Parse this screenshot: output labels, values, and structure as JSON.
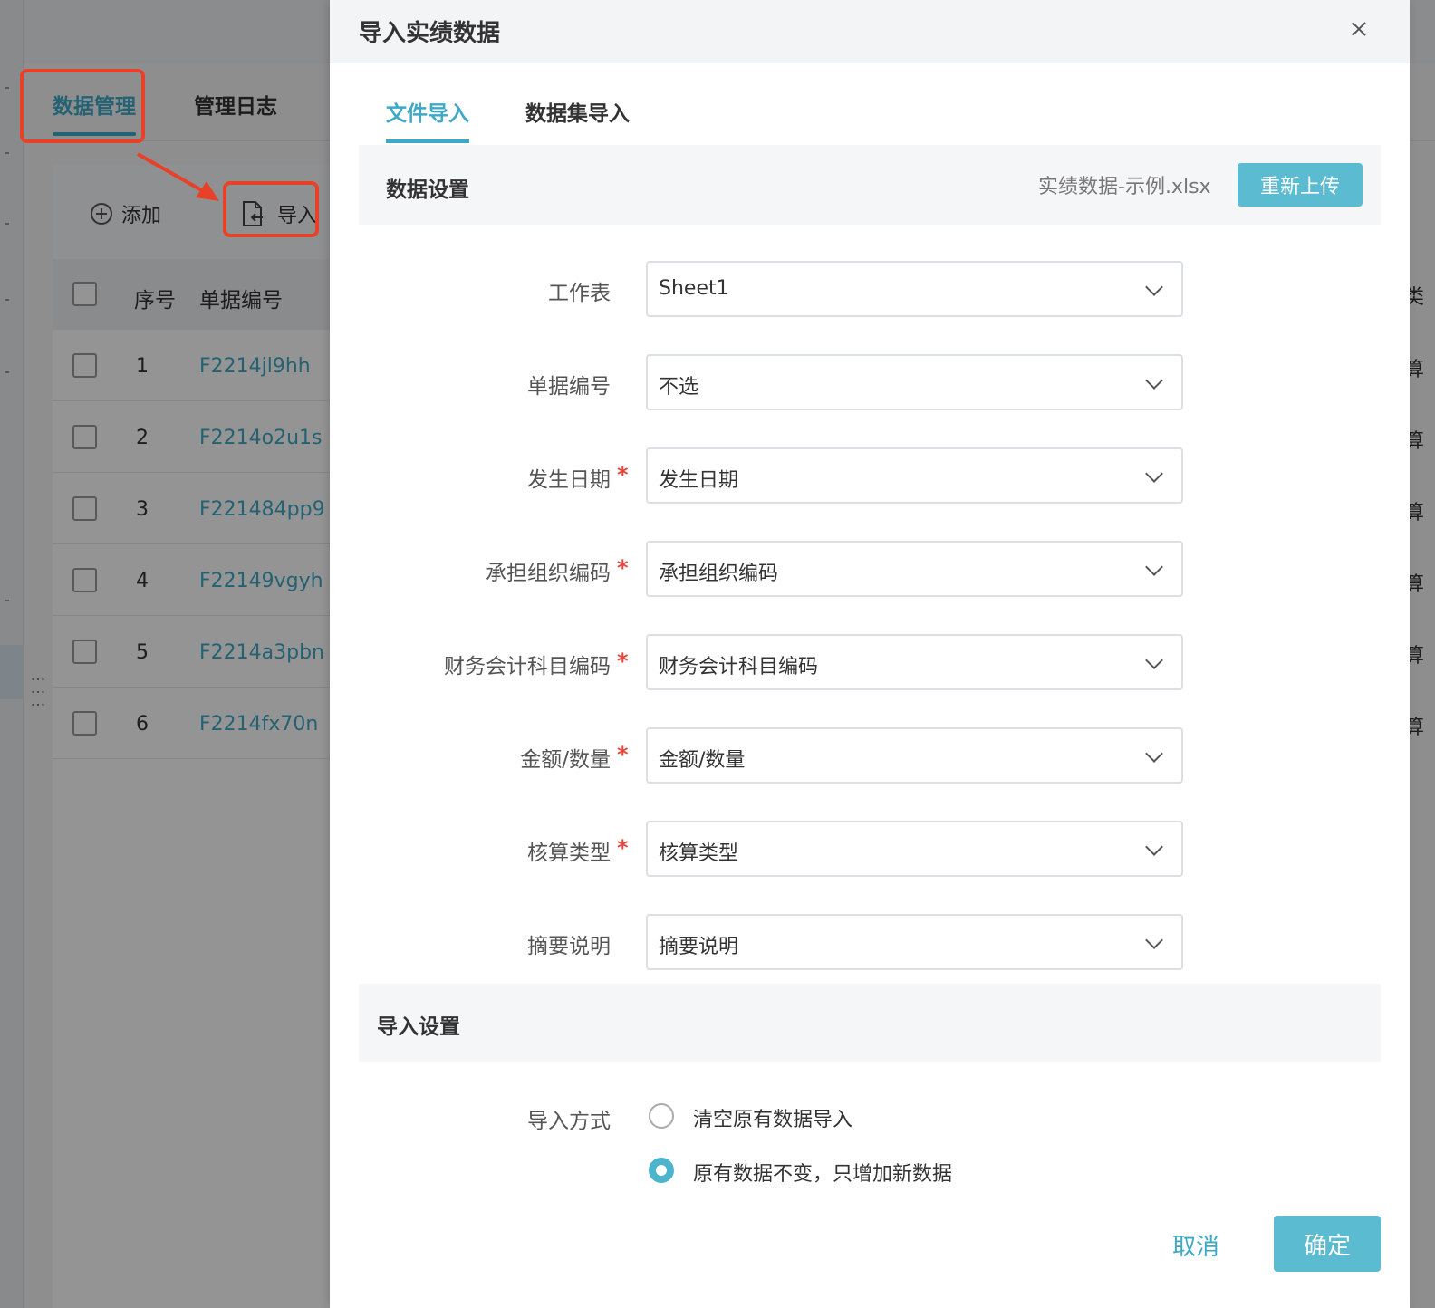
{
  "background": {
    "tabs": [
      "数据管理",
      "管理日志"
    ],
    "toolbar": {
      "add_label": "添加",
      "import_label": "导入"
    },
    "table": {
      "headers": [
        "序号",
        "单据编号"
      ],
      "rows": [
        {
          "index": "1",
          "code": "F2214jl9hh"
        },
        {
          "index": "2",
          "code": "F2214o2u1s"
        },
        {
          "index": "3",
          "code": "F221484pp9"
        },
        {
          "index": "4",
          "code": "F22149vgyh"
        },
        {
          "index": "5",
          "code": "F2214a3pbn"
        },
        {
          "index": "6",
          "code": "F2214fx70n"
        }
      ]
    },
    "right_edge_glyphs": [
      "类",
      "算",
      "算",
      "算",
      "算",
      "算",
      "算"
    ]
  },
  "modal": {
    "title": "导入实绩数据",
    "tabs": [
      "文件导入",
      "数据集导入"
    ],
    "data_settings": {
      "title": "数据设置",
      "filename": "实绩数据-示例.xlsx",
      "reupload_label": "重新上传"
    },
    "fields": [
      {
        "label": "工作表",
        "required": false,
        "value": "Sheet1"
      },
      {
        "label": "单据编号",
        "required": false,
        "value": "不选"
      },
      {
        "label": "发生日期",
        "required": true,
        "value": "发生日期"
      },
      {
        "label": "承担组织编码",
        "required": true,
        "value": "承担组织编码"
      },
      {
        "label": "财务会计科目编码",
        "required": true,
        "value": "财务会计科目编码"
      },
      {
        "label": "金额/数量",
        "required": true,
        "value": "金额/数量"
      },
      {
        "label": "核算类型",
        "required": true,
        "value": "核算类型"
      },
      {
        "label": "摘要说明",
        "required": false,
        "value": "摘要说明"
      }
    ],
    "required_mark": "*",
    "import_settings": {
      "title": "导入设置",
      "mode_label": "导入方式",
      "options": [
        {
          "label": "清空原有数据导入",
          "selected": false
        },
        {
          "label": "原有数据不变，只增加新数据",
          "selected": true
        }
      ]
    },
    "cancel_label": "取消",
    "confirm_label": "确定"
  },
  "colors": {
    "accent": "#3ea9c6",
    "button": "#5bbcd1",
    "required": "#e5463a",
    "highlight_box": "#e8412a"
  }
}
